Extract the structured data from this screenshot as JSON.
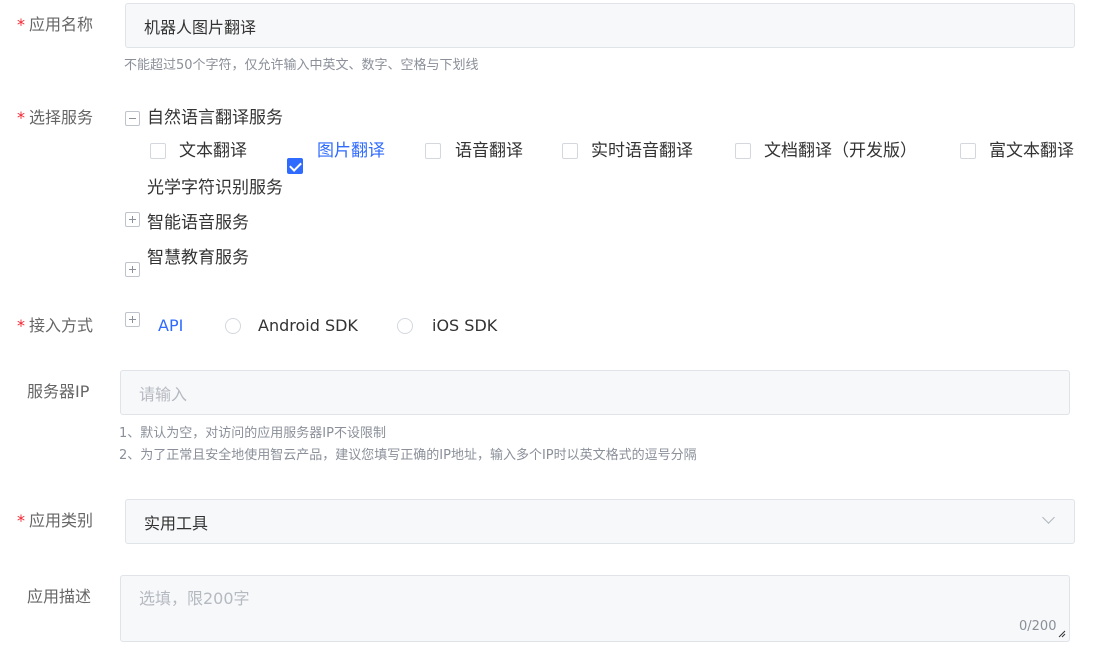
{
  "app_name": {
    "label": "应用名称",
    "value": "机器人图片翻译",
    "hint": "不能超过50个字符，仅允许输入中英文、数字、空格与下划线"
  },
  "service": {
    "label": "选择服务",
    "groups": [
      {
        "name": "自然语言翻译服务",
        "expanded": true,
        "items": [
          {
            "label": "文本翻译",
            "checked": false
          },
          {
            "label": "图片翻译",
            "checked": true
          },
          {
            "label": "语音翻译",
            "checked": false
          },
          {
            "label": "实时语音翻译",
            "checked": false
          },
          {
            "label": "文档翻译（开发版）",
            "checked": false
          },
          {
            "label": "富文本翻译",
            "checked": false
          }
        ]
      },
      {
        "name": "光学字符识别服务",
        "expanded": false
      },
      {
        "name": "智能语音服务",
        "expanded": false
      },
      {
        "name": "智慧教育服务",
        "expanded": false
      }
    ]
  },
  "access": {
    "label": "接入方式",
    "options": [
      {
        "label": "API",
        "selected": true
      },
      {
        "label": "Android SDK",
        "selected": false
      },
      {
        "label": "iOS SDK",
        "selected": false
      }
    ]
  },
  "server_ip": {
    "label": "服务器IP",
    "placeholder": "请输入",
    "hints": [
      "1、默认为空，对访问的应用服务器IP不设限制",
      "2、为了正常且安全地使用智云产品，建议您填写正确的IP地址，输入多个IP时以英文格式的逗号分隔"
    ]
  },
  "category": {
    "label": "应用类别",
    "value": "实用工具"
  },
  "description": {
    "label": "应用描述",
    "placeholder": "选填，限200字",
    "counter": "0/200"
  },
  "colors": {
    "accent": "#2f6bff",
    "required": "#f5222d"
  }
}
